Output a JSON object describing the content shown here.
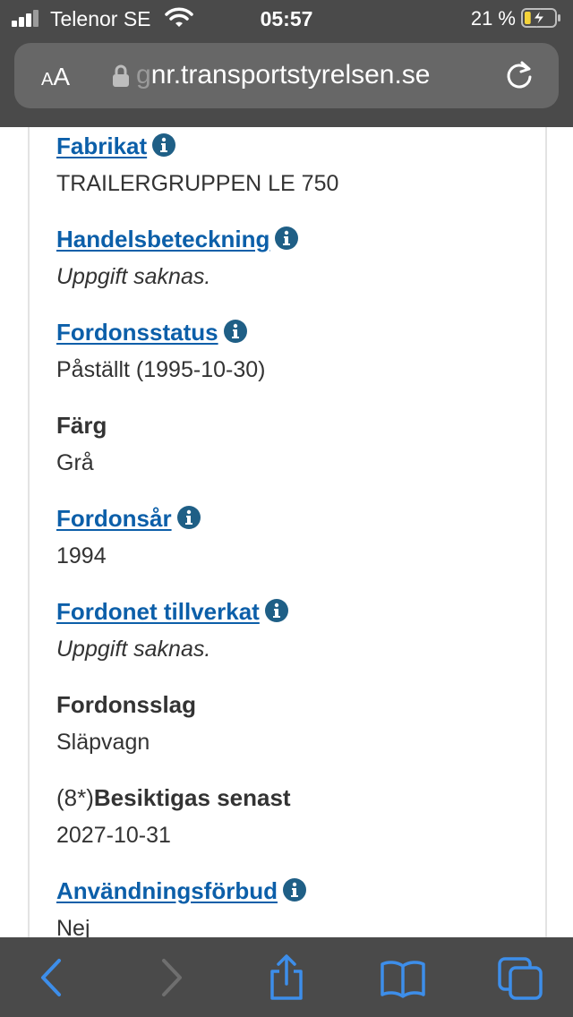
{
  "status_bar": {
    "carrier": "Telenor SE",
    "time": "05:57",
    "battery_percent": "21 %",
    "battery_level": 0.21,
    "charging": true
  },
  "browser": {
    "text_size_label": {
      "small": "A",
      "large": "A"
    },
    "url_faded": "g",
    "url_visible": "nr.transportstyrelsen.se",
    "secure": true
  },
  "fields": [
    {
      "label": "Fabrikat",
      "value": "TRAILERGRUPPEN LE 750",
      "has_info": true,
      "is_link": true,
      "italic": false
    },
    {
      "label": "Handelsbeteckning",
      "value": "Uppgift saknas.",
      "has_info": true,
      "is_link": true,
      "italic": true
    },
    {
      "label": "Fordonsstatus",
      "value": "Påställt (1995-10-30)",
      "has_info": true,
      "is_link": true,
      "italic": false
    },
    {
      "label": "Färg",
      "value": "Grå",
      "has_info": false,
      "is_link": false,
      "italic": false
    },
    {
      "label": "Fordonsår",
      "value": "1994",
      "has_info": true,
      "is_link": true,
      "italic": false
    },
    {
      "label": "Fordonet tillverkat",
      "value": "Uppgift saknas.",
      "has_info": true,
      "is_link": true,
      "italic": true
    },
    {
      "label": "Fordonsslag",
      "value": "Släpvagn",
      "has_info": false,
      "is_link": false,
      "italic": false
    },
    {
      "label_prefix": "(8*)",
      "label": "Besiktigas senast",
      "value": "2027-10-31",
      "has_info": false,
      "is_link": false,
      "italic": false
    },
    {
      "label": "Användningsförbud",
      "value": "Nej",
      "has_info": true,
      "is_link": true,
      "italic": false
    }
  ],
  "toolbar": {
    "icons": [
      "back-icon",
      "forward-icon",
      "share-icon",
      "bookmarks-icon",
      "tabs-icon"
    ],
    "forward_enabled": false
  },
  "colors": {
    "chrome": "#4a4a4a",
    "url_bar": "#676767",
    "link": "#0c5fa9",
    "info_icon": "#1f5f86",
    "toolbar_icon": "#3d8eea",
    "battery_fill": "#f4d33a"
  }
}
